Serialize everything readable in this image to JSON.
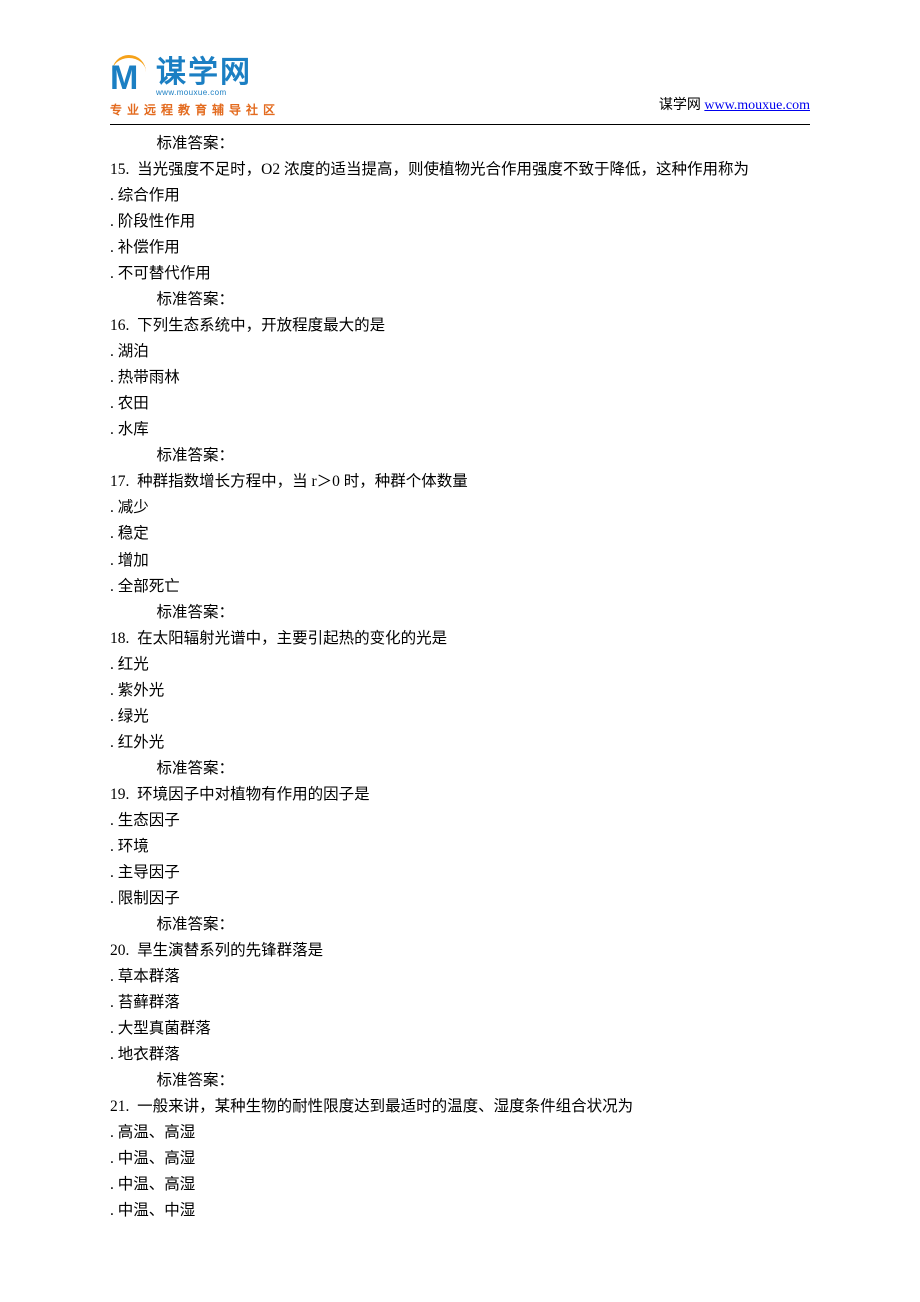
{
  "header": {
    "logo_main": "谋学网",
    "logo_url": "www.mouxue.com",
    "logo_tagline": "专业远程教育辅导社区",
    "site_label": "谋学网",
    "site_url": "www.mouxue.com"
  },
  "answer_label": "标准答案：",
  "questions": [
    {
      "num": "15.",
      "text": "当光强度不足时，O2 浓度的适当提高，则使植物光合作用强度不致于降低，这种作用称为",
      "options": [
        "综合作用",
        "阶段性作用",
        "补偿作用",
        "不可替代作用"
      ]
    },
    {
      "num": "16.",
      "text": "下列生态系统中，开放程度最大的是",
      "options": [
        "湖泊",
        "热带雨林",
        "农田",
        "水库"
      ]
    },
    {
      "num": "17.",
      "text": "种群指数增长方程中，当 r＞0 时，种群个体数量",
      "options": [
        "减少",
        "稳定",
        "增加",
        "全部死亡"
      ]
    },
    {
      "num": "18.",
      "text": "在太阳辐射光谱中，主要引起热的变化的光是",
      "options": [
        "红光",
        "紫外光",
        "绿光",
        "红外光"
      ]
    },
    {
      "num": "19.",
      "text": "环境因子中对植物有作用的因子是",
      "options": [
        "生态因子",
        "环境",
        "主导因子",
        "限制因子"
      ]
    },
    {
      "num": "20.",
      "text": "旱生演替系列的先锋群落是",
      "options": [
        "草本群落",
        "苔藓群落",
        "大型真菌群落",
        "地衣群落"
      ]
    },
    {
      "num": "21.",
      "text": "一般来讲，某种生物的耐性限度达到最适时的温度、湿度条件组合状况为",
      "options": [
        "高温、高湿",
        "中温、高湿",
        "中温、高湿",
        "中温、中湿"
      ]
    }
  ]
}
